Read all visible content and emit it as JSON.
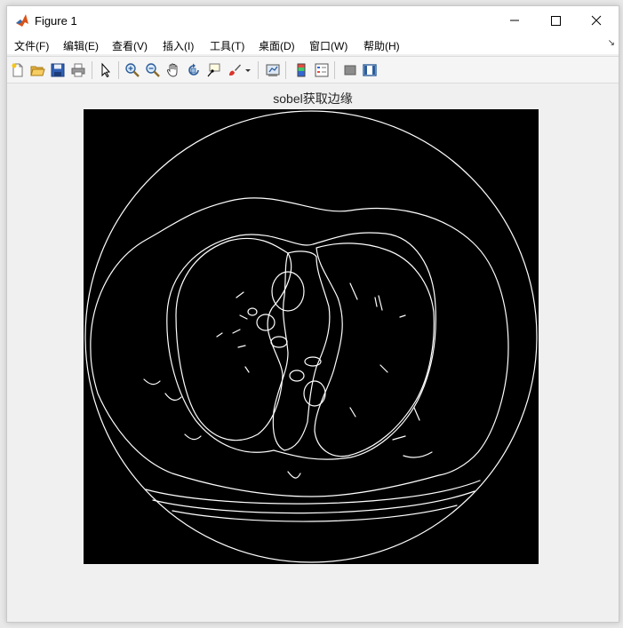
{
  "window": {
    "title": "Figure 1"
  },
  "menu": [
    {
      "label": "文件(F)"
    },
    {
      "label": "编辑(E)"
    },
    {
      "label": "查看(V)"
    },
    {
      "label": "插入(I)"
    },
    {
      "label": "工具(T)"
    },
    {
      "label": "桌面(D)"
    },
    {
      "label": "窗口(W)"
    },
    {
      "label": "帮助(H)"
    }
  ],
  "toolbar": {
    "icons": [
      "new-figure-icon",
      "open-file-icon",
      "save-icon",
      "print-icon",
      "pointer-icon",
      "zoom-in-icon",
      "zoom-out-icon",
      "pan-icon",
      "rotate-3d-icon",
      "data-cursor-icon",
      "brush-icon",
      "link-plot-icon",
      "colorbar-icon",
      "legend-icon",
      "hide-plot-tools-icon",
      "show-plot-tools-icon"
    ]
  },
  "figure": {
    "title": "sobel获取边缘",
    "image_description": "Sobel edge map of a chest CT slice: white edge lines on black background"
  },
  "colors": {
    "background": "#f0f0f0",
    "image_background": "#000000",
    "edges": "#ffffff"
  }
}
